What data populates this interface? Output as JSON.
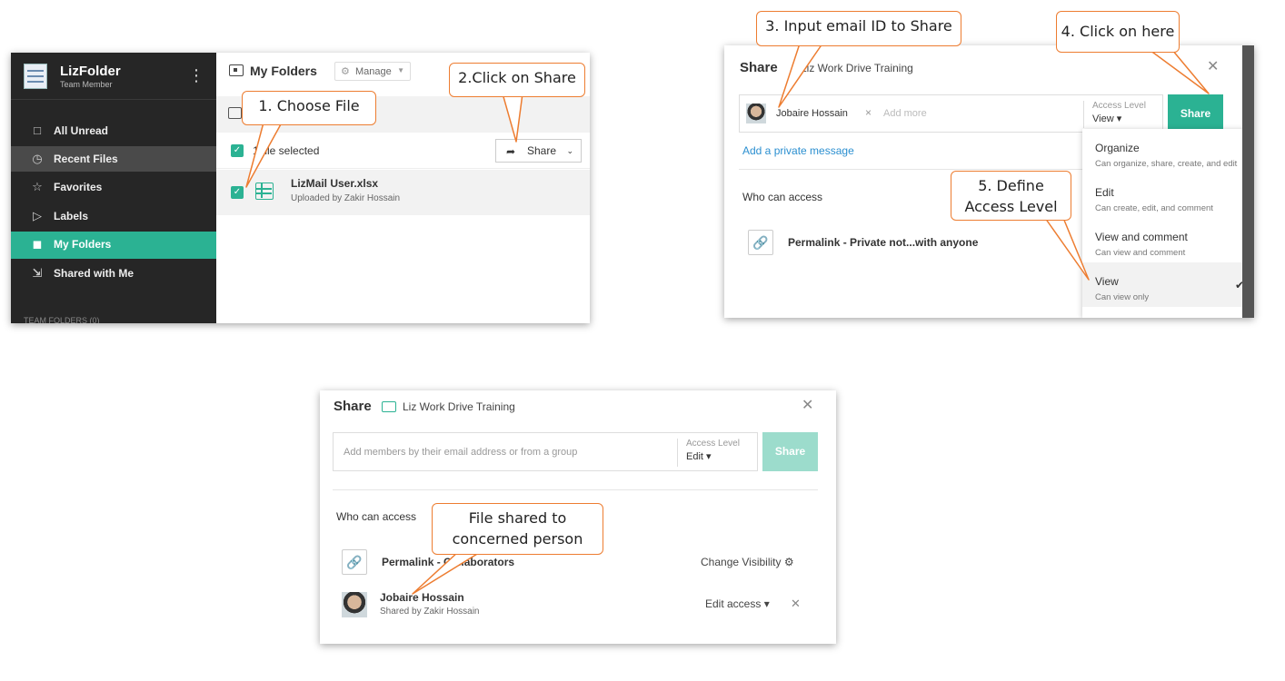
{
  "panel1": {
    "app_name": "LizFolder",
    "user_role": "Team Member",
    "sidebar": [
      {
        "label": "All Unread",
        "icon": "all-unread-icon"
      },
      {
        "label": "Recent Files",
        "icon": "clock-icon"
      },
      {
        "label": "Favorites",
        "icon": "star-icon"
      },
      {
        "label": "Labels",
        "icon": "label-icon"
      },
      {
        "label": "My Folders",
        "icon": "folder-icon"
      },
      {
        "label": "Shared with Me",
        "icon": "shared-folder-icon"
      }
    ],
    "sidebar_footer": "TEAM FOLDERS (0)",
    "page_title": "My Folders",
    "manage_label": "Manage",
    "selected_text": "1 file selected",
    "share_label": "Share",
    "file_name": "LizMail User.xlsx",
    "file_sub": "Uploaded by Zakir Hossain"
  },
  "panel2": {
    "title": "Share",
    "folder": "Liz Work Drive Training",
    "chip_name": "Jobaire Hossain",
    "add_more": "Add more",
    "access_level_label": "Access Level",
    "access_level_value": "View",
    "share_button": "Share",
    "private_message": "Add a private message",
    "who_can_access": "Who can access",
    "permalink": "Permalink - Private not...with anyone",
    "menu": [
      {
        "title": "Organize",
        "desc": "Can organize, share, create, and edit"
      },
      {
        "title": "Edit",
        "desc": "Can create, edit, and comment"
      },
      {
        "title": "View and comment",
        "desc": "Can view and comment"
      },
      {
        "title": "View",
        "desc": "Can view only",
        "selected": true
      }
    ]
  },
  "panel3": {
    "title": "Share",
    "folder": "Liz Work Drive Training",
    "placeholder": "Add members by their email address or from a group",
    "access_level_label": "Access Level",
    "access_level_value": "Edit",
    "share_button": "Share",
    "who_can_access": "Who can access",
    "permalink": "Permalink - Collaborators",
    "change_visibility": "Change Visibility",
    "person_name": "Jobaire Hossain",
    "person_sub": "Shared by Zakir Hossain",
    "edit_access": "Edit access"
  },
  "callouts": {
    "c1": "1. Choose File",
    "c2": "2.Click on Share",
    "c3": "3. Input email ID to Share",
    "c4": "4. Click on here",
    "c5_line1": "5. Define",
    "c5_line2": "Access Level",
    "c6_line1": "File shared to",
    "c6_line2": "concerned person"
  },
  "colors": {
    "accent": "#2bb293",
    "sidebar": "#262626",
    "callout_border": "#ed7d31",
    "link": "#2b8fd0"
  }
}
